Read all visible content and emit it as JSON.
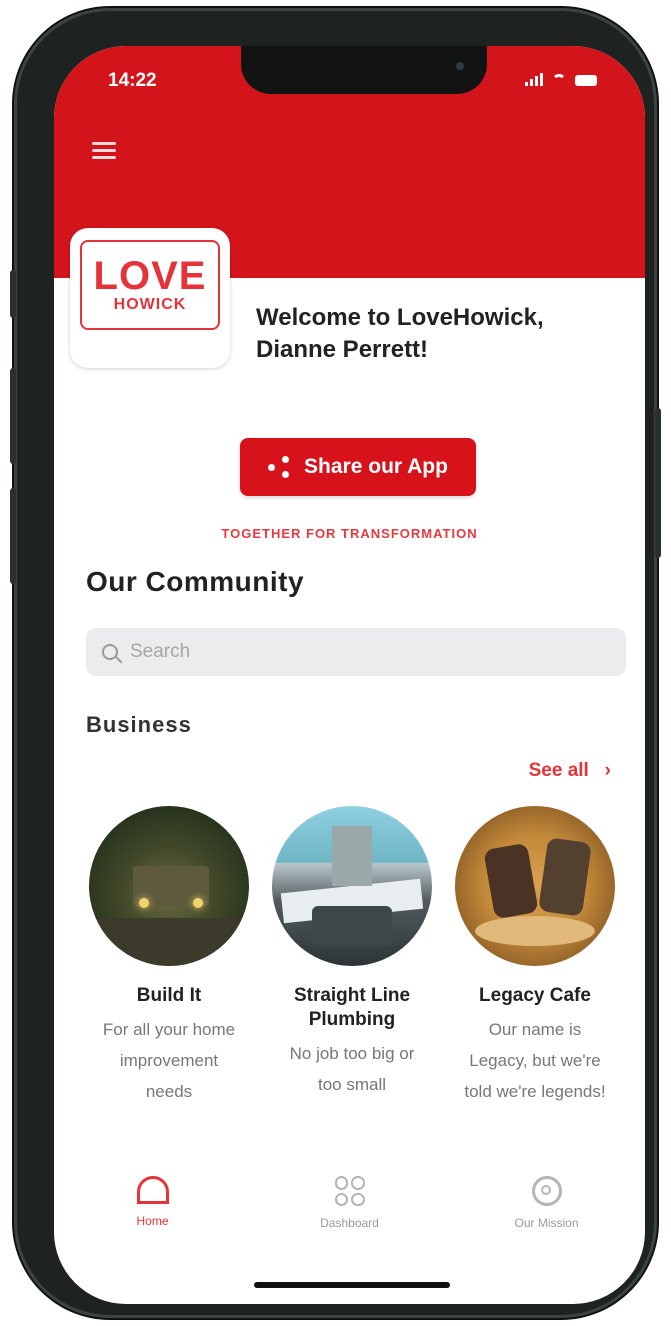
{
  "status_bar": {
    "time": "14:22"
  },
  "header": {
    "menu_icon": "hamburger-menu-icon",
    "brand_color": "#d4141b"
  },
  "logo": {
    "line1": "LOVE",
    "line2": "HOWICK"
  },
  "welcome": {
    "text": "Welcome to LoveHowick, Dianne Perrett!"
  },
  "share_button": {
    "label": "Share our App",
    "icon": "share-icon"
  },
  "tagline": "TOGETHER FOR TRANSFORMATION",
  "community": {
    "title": "Our Community",
    "search": {
      "placeholder": "Search",
      "value": ""
    },
    "business": {
      "title": "Business",
      "see_all": "See all",
      "items": [
        {
          "name": "Build It",
          "description": "For all your home improvement needs"
        },
        {
          "name": "Straight Line Plumbing",
          "description": "No job too big or too small"
        },
        {
          "name": "Legacy Cafe",
          "description": "Our name is Legacy, but we're told we're legends!"
        }
      ]
    }
  },
  "tabs": [
    {
      "label": "Home",
      "icon": "home-icon",
      "active": true
    },
    {
      "label": "Dashboard",
      "icon": "dashboard-icon",
      "active": false
    },
    {
      "label": "Our Mission",
      "icon": "mission-icon",
      "active": false
    }
  ]
}
